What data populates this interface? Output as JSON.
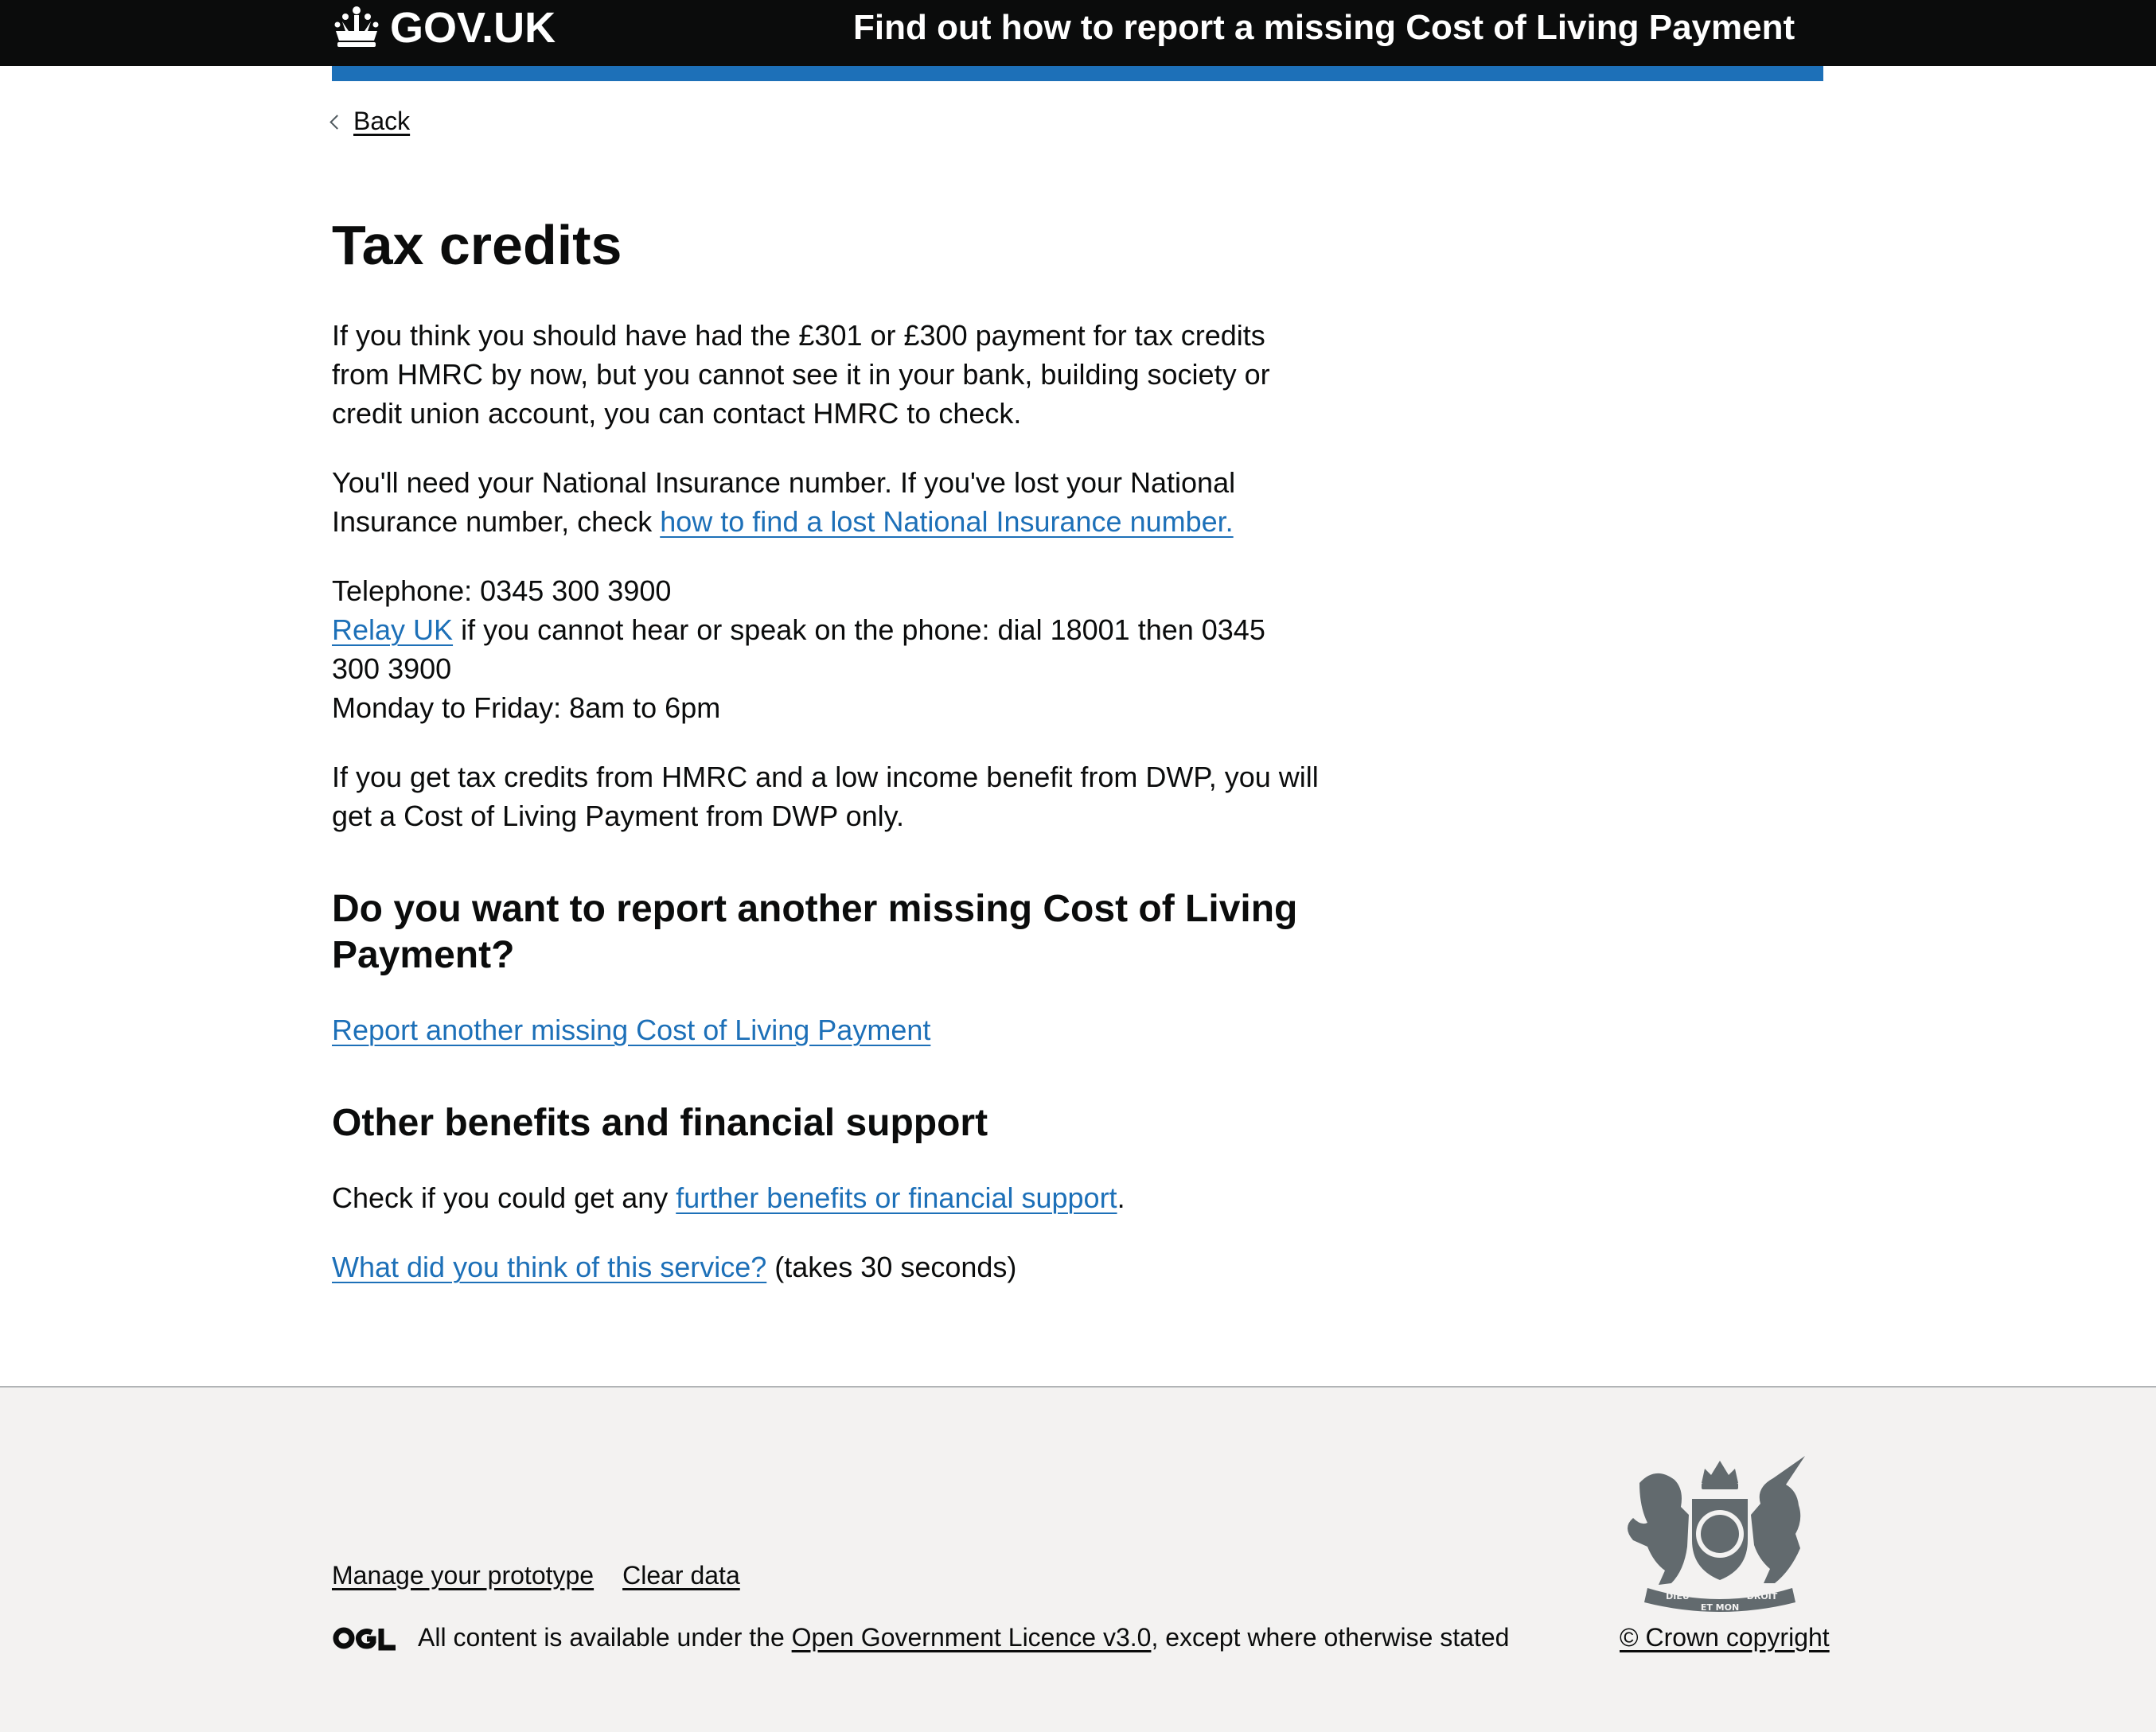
{
  "header": {
    "logo_text": "GOV.UK",
    "service_name": "Find out how to report a missing Cost of Living Payment"
  },
  "back_link": {
    "label": "Back"
  },
  "main": {
    "title": "Tax credits",
    "para1": "If you think you should have had the £301 or £300 payment for tax credits from HMRC by now, but you cannot see it in your bank, building society or credit union account, you can contact HMRC to check.",
    "para2_before": "You'll need your National Insurance number. If you've lost your National Insurance number, check ",
    "para2_link": "how to find a lost National Insurance number.",
    "contact": {
      "telephone": "Telephone: 0345 300 3900",
      "relay_link": "Relay UK",
      "relay_text": " if you cannot hear or speak on the phone: dial 18001 then 0345 300 3900",
      "hours": "Monday to Friday: 8am to 6pm"
    },
    "para3": "If you get tax credits from HMRC and a low income benefit from DWP, you will get a Cost of Living Payment from DWP only.",
    "h2_report": "Do you want to report another missing Cost of Living Payment?",
    "report_link": "Report another missing Cost of Living Payment",
    "h2_other": "Other benefits and financial support",
    "other_before": "Check if you could get any ",
    "other_link": "further benefits or financial support",
    "other_after": ".",
    "feedback_link": "What did you think of this service?",
    "feedback_after": " (takes 30 seconds)"
  },
  "footer": {
    "links": [
      "Manage your prototype",
      "Clear data"
    ],
    "licence_before": "All content is available under the ",
    "licence_link": "Open Government Licence v3.0",
    "licence_after": ", except where otherwise stated",
    "copyright": "© Crown copyright",
    "crest_motto_1": "DIEU",
    "crest_motto_2": "ET MON",
    "crest_motto_3": "DROIT"
  },
  "colors": {
    "header_bg": "#0b0c0c",
    "brand_blue": "#1d70b8",
    "link_blue": "#1d70b8",
    "footer_bg": "#f3f2f1",
    "crest_grey": "#626a6e"
  },
  "icons": [
    "crown-icon",
    "back-chevron-icon",
    "ogl-logo-icon",
    "royal-crest-icon"
  ]
}
